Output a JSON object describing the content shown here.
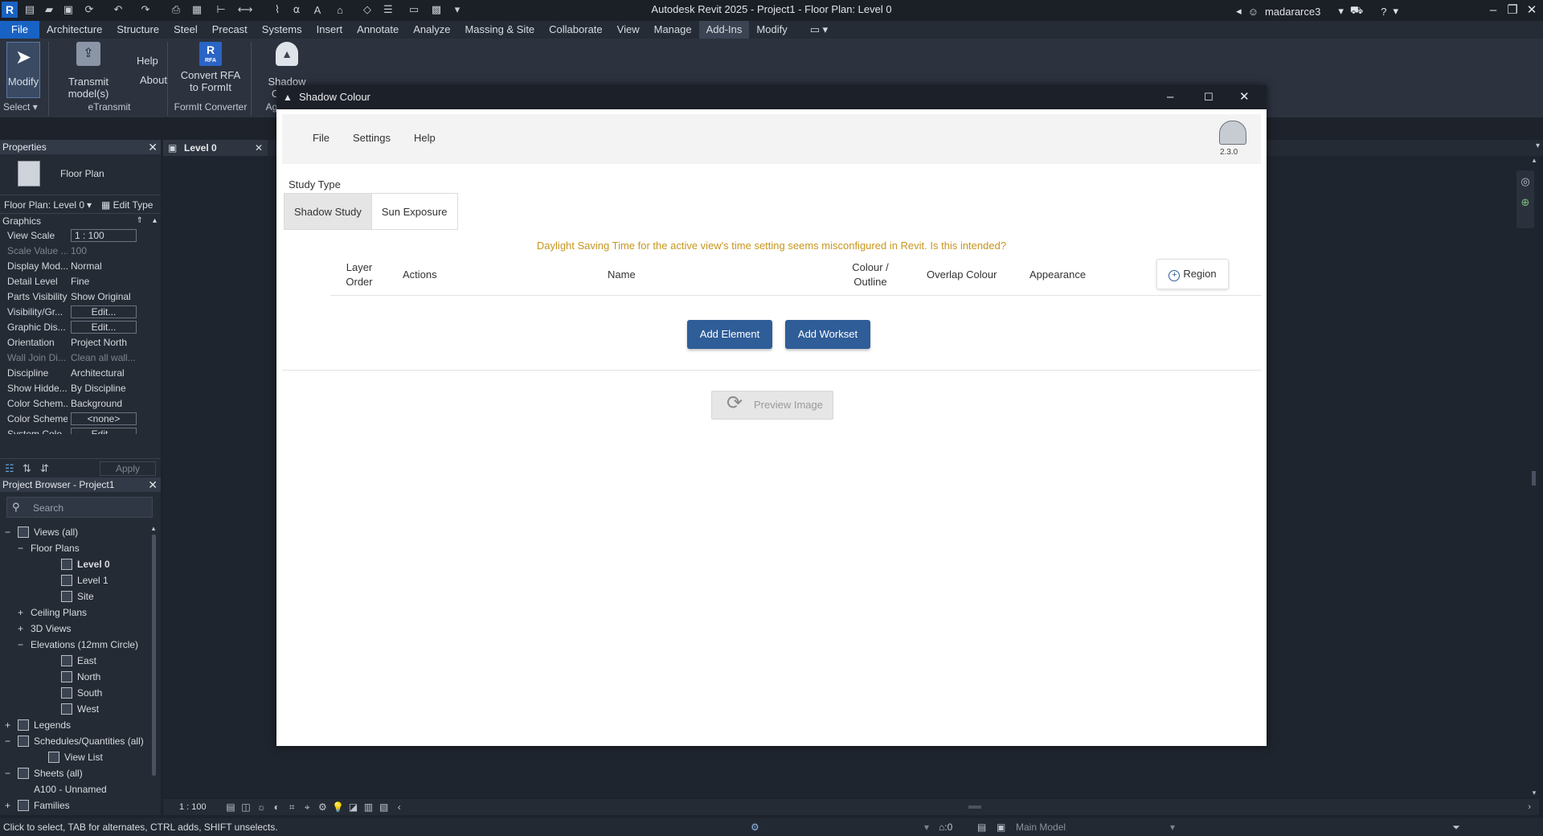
{
  "app": {
    "title": "Autodesk Revit 2025 - Project1 - Floor Plan: Level 0",
    "logo": "R",
    "user": "madararce3"
  },
  "ribbon_tabs": [
    "File",
    "Architecture",
    "Structure",
    "Steel",
    "Precast",
    "Systems",
    "Insert",
    "Annotate",
    "Analyze",
    "Massing & Site",
    "Collaborate",
    "View",
    "Manage",
    "Add-Ins",
    "Modify"
  ],
  "ribbon": {
    "modify": "Modify",
    "transmit": "Transmit model(s)",
    "help": "Help",
    "about": "About",
    "convert_rfa_1": "Convert RFA",
    "convert_rfa_2": "to FormIt",
    "rfa_badge": "RFA",
    "shadow_colour": "Shadow Colour",
    "groups": {
      "select": "Select",
      "etransmit": "eTransmit",
      "formit": "FormIt Converter",
      "ag": "Ag"
    }
  },
  "properties": {
    "title": "Properties",
    "type_name": "Floor Plan",
    "selector": "Floor Plan: Level 0",
    "edit_type": "Edit Type",
    "section": "Graphics",
    "rows": [
      {
        "k": "View Scale",
        "v": "1 : 100"
      },
      {
        "k": "Scale Value ...",
        "v": "100"
      },
      {
        "k": "Display Mod...",
        "v": "Normal"
      },
      {
        "k": "Detail Level",
        "v": "Fine"
      },
      {
        "k": "Parts Visibility",
        "v": "Show Original"
      },
      {
        "k": "Visibility/Gr...",
        "v": "Edit..."
      },
      {
        "k": "Graphic Dis...",
        "v": "Edit..."
      },
      {
        "k": "Orientation",
        "v": "Project North"
      },
      {
        "k": "Wall Join Di...",
        "v": "Clean all wall..."
      },
      {
        "k": "Discipline",
        "v": "Architectural"
      },
      {
        "k": "Show Hidde...",
        "v": "By Discipline"
      },
      {
        "k": "Color Schem...",
        "v": "Background"
      },
      {
        "k": "Color Scheme",
        "v": "<none>"
      },
      {
        "k": "System Colo...",
        "v": "Edit..."
      }
    ],
    "apply": "Apply"
  },
  "browser": {
    "title": "Project Browser - Project1",
    "search_placeholder": "Search",
    "items": [
      {
        "label": "Views (all)",
        "toggle": "−",
        "level": 0,
        "bold": false
      },
      {
        "label": "Floor Plans",
        "toggle": "−",
        "level": 1,
        "bold": false
      },
      {
        "label": "Level 0",
        "toggle": "",
        "level": 2,
        "bold": true
      },
      {
        "label": "Level 1",
        "toggle": "",
        "level": 2,
        "bold": false
      },
      {
        "label": "Site",
        "toggle": "",
        "level": 2,
        "bold": false
      },
      {
        "label": "Ceiling Plans",
        "toggle": "+",
        "level": 1,
        "bold": false
      },
      {
        "label": "3D Views",
        "toggle": "+",
        "level": 1,
        "bold": false
      },
      {
        "label": "Elevations (12mm Circle)",
        "toggle": "−",
        "level": 1,
        "bold": false
      },
      {
        "label": "East",
        "toggle": "",
        "level": 2,
        "bold": false
      },
      {
        "label": "North",
        "toggle": "",
        "level": 2,
        "bold": false
      },
      {
        "label": "South",
        "toggle": "",
        "level": 2,
        "bold": false
      },
      {
        "label": "West",
        "toggle": "",
        "level": 2,
        "bold": false
      },
      {
        "label": "Legends",
        "toggle": "+",
        "level": 0,
        "bold": false
      },
      {
        "label": "Schedules/Quantities (all)",
        "toggle": "−",
        "level": 0,
        "bold": false
      },
      {
        "label": "View List",
        "toggle": "",
        "level": 1,
        "bold": false
      },
      {
        "label": "Sheets (all)",
        "toggle": "−",
        "level": 0,
        "bold": false
      },
      {
        "label": "A100 - Unnamed",
        "toggle": "",
        "level": 1,
        "bold": false
      },
      {
        "label": "Families",
        "toggle": "+",
        "level": 0,
        "bold": false
      }
    ]
  },
  "view_tab": {
    "label": "Level 0",
    "scale": "1 : 100"
  },
  "status": {
    "hint": "Click to select, TAB for alternates, CTRL adds, SHIFT unselects.",
    "count0": ":0",
    "model": "Main Model",
    "filter": ":0"
  },
  "dialog": {
    "title": "Shadow Colour",
    "menu": [
      "File",
      "Settings",
      "Help"
    ],
    "version": "2.3.0",
    "study_type_label": "Study Type",
    "tabs": [
      "Shadow Study",
      "Sun Exposure"
    ],
    "warning": "Daylight Saving Time for the active view's time setting seems misconfigured in Revit. Is this intended?",
    "warning_color": "#c8961e",
    "columns": {
      "layer_1": "Layer",
      "layer_2": "Order",
      "actions": "Actions",
      "name": "Name",
      "colour_1": "Colour /",
      "colour_2": "Outline",
      "overlap": "Overlap Colour",
      "appearance": "Appearance"
    },
    "region_button": "Region",
    "add_element": "Add Element",
    "add_workset": "Add Workset",
    "preview": "Preview Image",
    "primary_color": "#2f5d98"
  }
}
